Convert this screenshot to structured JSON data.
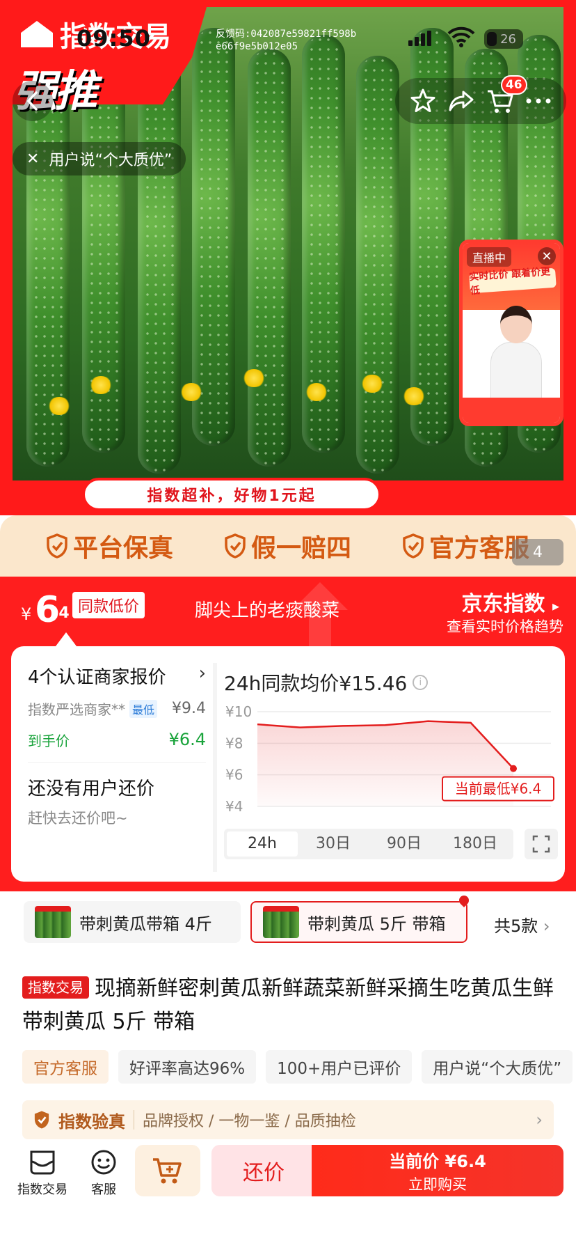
{
  "status_bar": {
    "time": "09:50",
    "feedback_code": "反馈码:042087e59821ff598be66f9e5b012e05",
    "battery": "26"
  },
  "hero": {
    "brand_name": "指数交易",
    "slogan": "强推",
    "banner": "指数超补，好物1元起",
    "user_tip": "用户说“个大质优”",
    "cart_count": "46",
    "live_badge": "直播中",
    "live_slogan": "实时比价 跟着价更低",
    "page_indicator": "4"
  },
  "guarantees": [
    "平台保真",
    "假一赔四",
    "官方客服"
  ],
  "price_band": {
    "currency": "¥",
    "price_int": "6",
    "price_dec": ".4",
    "same_low_tag": "同款低价",
    "product_short": "脚尖上的老痰酸菜",
    "jd_index": "京东指数",
    "jd_sub": "查看实时价格趋势"
  },
  "merchants": {
    "title": "4个认证商家报价",
    "seller": "指数严选商家**",
    "lowest_tag": "最低",
    "seller_price": "¥9.4",
    "net_label": "到手价",
    "net_price": "¥6.4"
  },
  "haggle_box": {
    "title": "还没有用户还价",
    "subtitle": "赶快去还价吧~"
  },
  "chart_title": "24h同款均价¥15.46",
  "chart_data": {
    "type": "area",
    "title": "24h同款均价¥15.46",
    "x": [
      0,
      1,
      2,
      3,
      4,
      5,
      6
    ],
    "y": [
      9.2,
      9.0,
      9.1,
      9.15,
      9.4,
      9.3,
      6.4
    ],
    "yticks": [
      "¥10",
      "¥8",
      "¥6",
      "¥4"
    ],
    "ylim": [
      4,
      10
    ],
    "grid": true,
    "color": "#e31d1d",
    "annotation": "当前最低¥6.4"
  },
  "ranges": [
    "24h",
    "30日",
    "90日",
    "180日"
  ],
  "active_range": "24h",
  "skus": [
    {
      "label": "带刺黄瓜带箱 4斤",
      "selected": false
    },
    {
      "label": "带刺黄瓜 5斤 带箱",
      "selected": true
    }
  ],
  "sku_more": "共5款",
  "product": {
    "brand_tag": "指数交易",
    "title": "现摘新鲜密刺黄瓜新鲜蔬菜新鲜采摘生吃黄瓜生鲜 带刺黄瓜 5斤 带箱"
  },
  "tags": [
    "官方客服",
    "好评率高达96%",
    "100+用户已评价",
    "用户说“个大质优”"
  ],
  "verify": {
    "title": "指数验真",
    "desc": "品牌授权 / 一物一鉴 / 品质抽检"
  },
  "bottom": {
    "shop": "指数交易",
    "service": "客服",
    "haggle": "还价",
    "buy_price": "当前价 ¥6.4",
    "buy_now": "立即购买"
  },
  "colors": {
    "brand_red": "#ff1e1e",
    "accent_red": "#e31d1d",
    "gold": "#d45a12",
    "green": "#19a33b"
  }
}
